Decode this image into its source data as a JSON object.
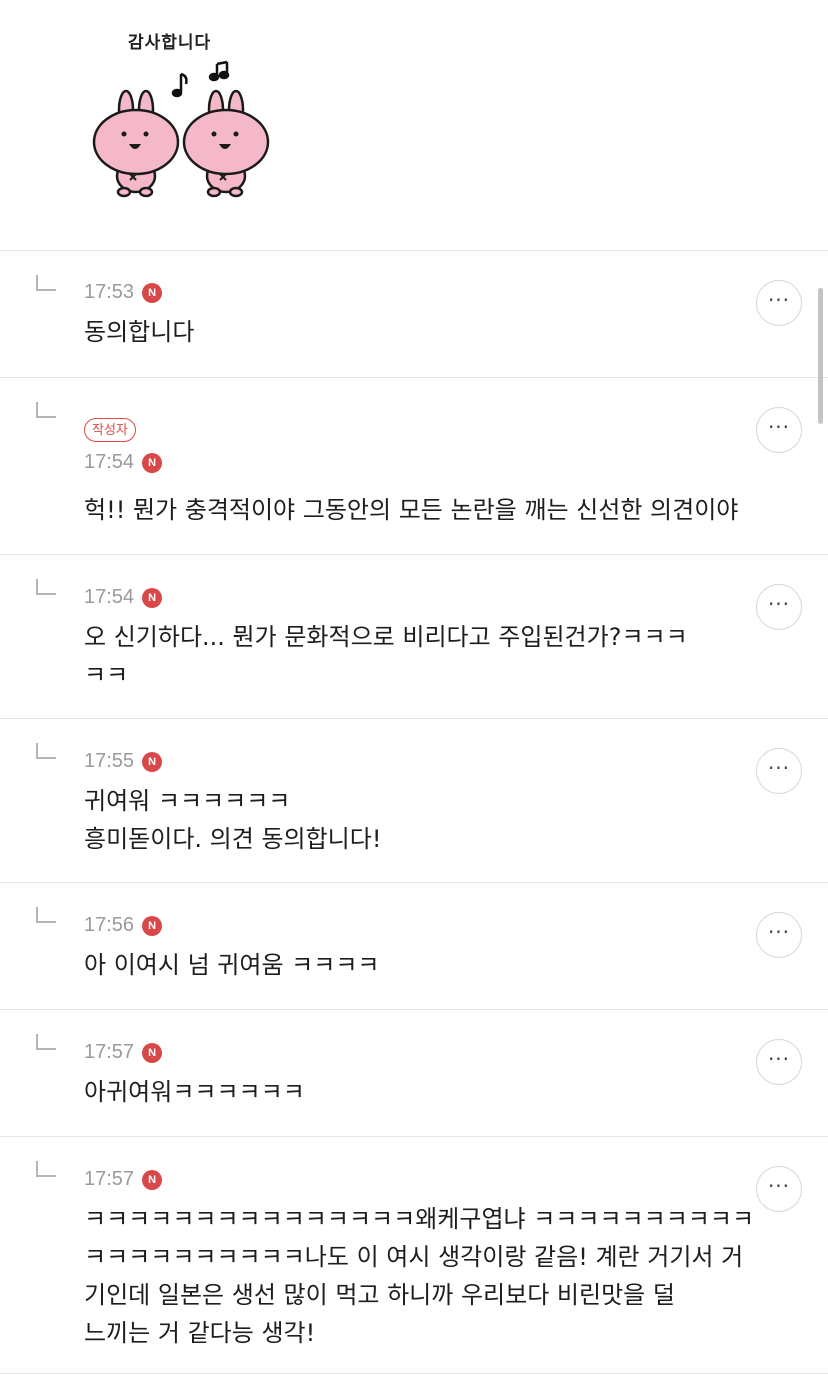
{
  "sticker": {
    "caption": "감사합니다",
    "icon": "bunny-pair-sticker"
  },
  "comments": [
    {
      "time": "17:53",
      "badge": "N",
      "author_badge": "",
      "lines": [
        "동의합니다"
      ]
    },
    {
      "time": "17:54",
      "badge": "N",
      "author_badge": "작성자",
      "lines": [
        "헉!! 뭔가 충격적이야 그동안의 모든 논란을 깨는 신선한 의견이야"
      ]
    },
    {
      "time": "17:54",
      "badge": "N",
      "author_badge": "",
      "lines": [
        "오 신기하다... 뭔가 문화적으로 비리다고 주입된건가?ㅋㅋㅋ",
        "ㅋㅋ"
      ]
    },
    {
      "time": "17:55",
      "badge": "N",
      "author_badge": "",
      "lines": [
        "귀여워 ㅋㅋㅋㅋㅋㅋ",
        "흥미돋이다. 의견 동의합니다!"
      ]
    },
    {
      "time": "17:56",
      "badge": "N",
      "author_badge": "",
      "lines": [
        "아 이여시 넘 귀여움 ㅋㅋㅋㅋ"
      ]
    },
    {
      "time": "17:57",
      "badge": "N",
      "author_badge": "",
      "lines": [
        "아귀여워ㅋㅋㅋㅋㅋㅋ"
      ]
    },
    {
      "time": "17:57",
      "badge": "N",
      "author_badge": "",
      "lines": [
        "ㅋㅋㅋㅋㅋㅋㅋㅋㅋㅋㅋㅋㅋㅋㅋ왜케구엽냐 ㅋㅋㅋㅋㅋㅋㅋㅋㅋㅋ",
        "ㅋㅋㅋㅋㅋㅋㅋㅋㅋㅋ나도 이 여시 생각이랑 같음! 계란 거기서 거",
        "기인데 일본은 생선 많이 먹고 하니까 우리보다 비린맛을 덜",
        "느끼는 거 같다능 생각!"
      ]
    }
  ],
  "more_button": {
    "icon": "more-horizontal-icon",
    "label": "···"
  },
  "colors": {
    "badge_red": "#d94848",
    "author_red": "#e04a4a",
    "time_gray": "#9a9a9a"
  }
}
